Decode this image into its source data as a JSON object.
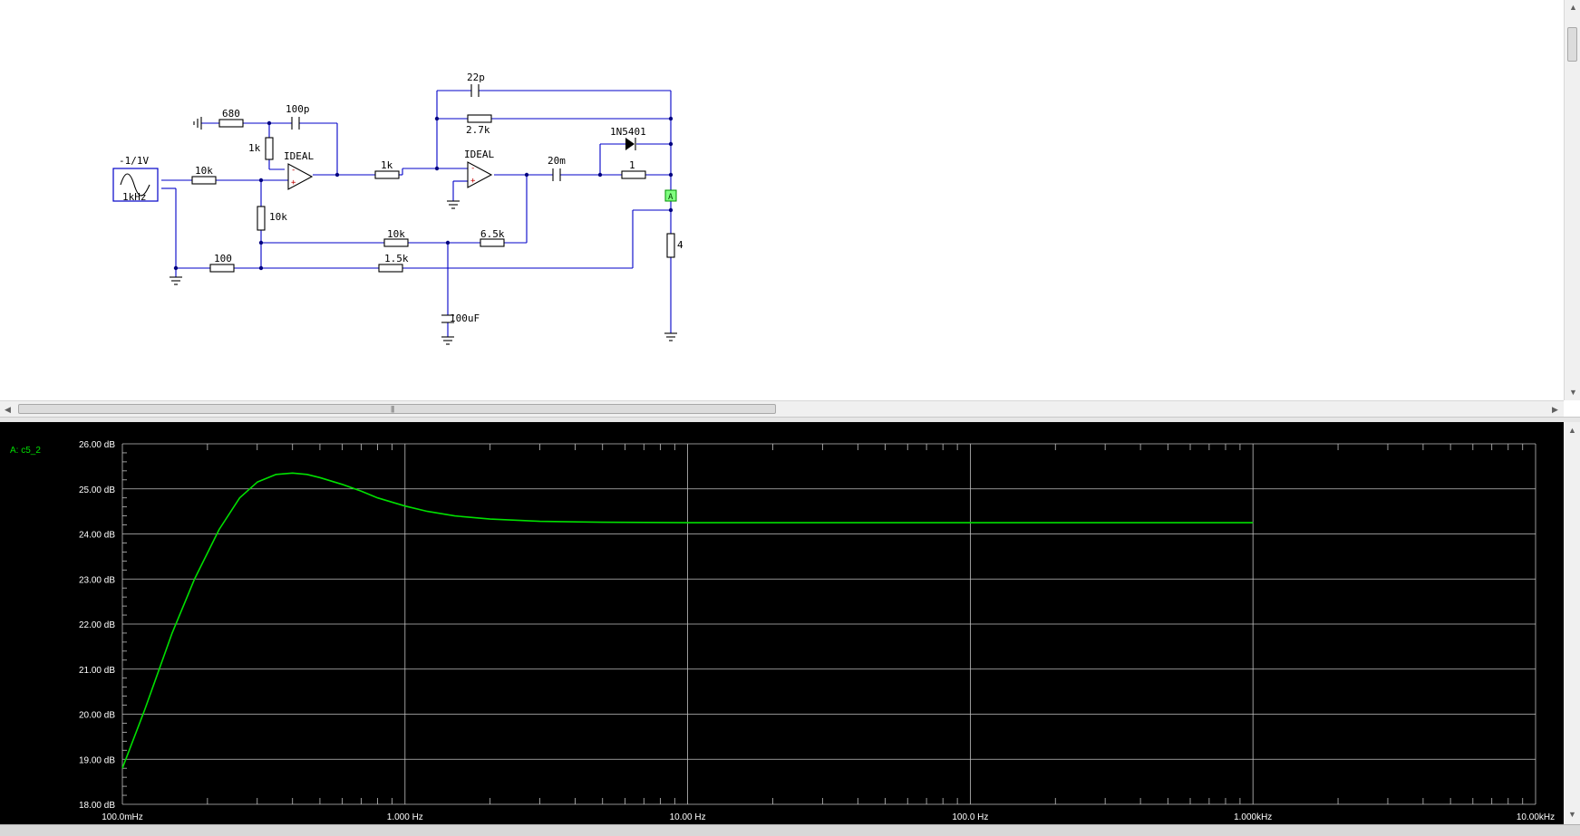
{
  "schematic": {
    "source": {
      "amplitude": "-1/1V",
      "frequency": "1kHz"
    },
    "components": {
      "r_in": "10k",
      "r_gnd_ref": "680",
      "c_ff": "100p",
      "r_fb1": "1k",
      "opamp1": "IDEAL",
      "r_bias": "10k",
      "r_mid": "1k",
      "c_fb": "22p",
      "r_fb2": "2.7k",
      "diode": "1N5401",
      "opamp2": "IDEAL",
      "c_out": "20m",
      "r_series": "1",
      "r_fb3": "10k",
      "r_fb4": "6.5k",
      "r_gnd": "100",
      "r_sense": "1.5k",
      "c_bulk": "100uF",
      "r_load": "4"
    },
    "probe_label": "A"
  },
  "plot": {
    "trace_label": "A: c5_2",
    "trace_color": "#00e000",
    "background": "#000000",
    "grid_color": "#c0c0c0"
  },
  "chart_data": {
    "type": "line",
    "xscale": "log",
    "x_ticks": [
      "100.0mHz",
      "1.000 Hz",
      "10.00 Hz",
      "100.0 Hz",
      "1.000kHz",
      "10.00kHz"
    ],
    "y_ticks": [
      "26.00 dB",
      "25.00 dB",
      "24.00 dB",
      "23.00 dB",
      "22.00 dB",
      "21.00 dB",
      "20.00 dB",
      "19.00 dB",
      "18.00 dB"
    ],
    "xlim": [
      0.1,
      10000
    ],
    "ylim": [
      18,
      26
    ],
    "grid": true,
    "series": [
      {
        "name": "A: c5_2",
        "x": [
          0.1,
          0.12,
          0.15,
          0.18,
          0.22,
          0.26,
          0.3,
          0.35,
          0.4,
          0.45,
          0.5,
          0.6,
          0.7,
          0.8,
          1.0,
          1.2,
          1.5,
          2,
          3,
          5,
          10,
          100,
          1000
        ],
        "y": [
          18.8,
          20.1,
          21.8,
          23.0,
          24.1,
          24.8,
          25.15,
          25.32,
          25.35,
          25.32,
          25.25,
          25.1,
          24.95,
          24.8,
          24.62,
          24.5,
          24.4,
          24.33,
          24.28,
          24.26,
          24.25,
          24.25,
          24.25
        ]
      }
    ]
  }
}
